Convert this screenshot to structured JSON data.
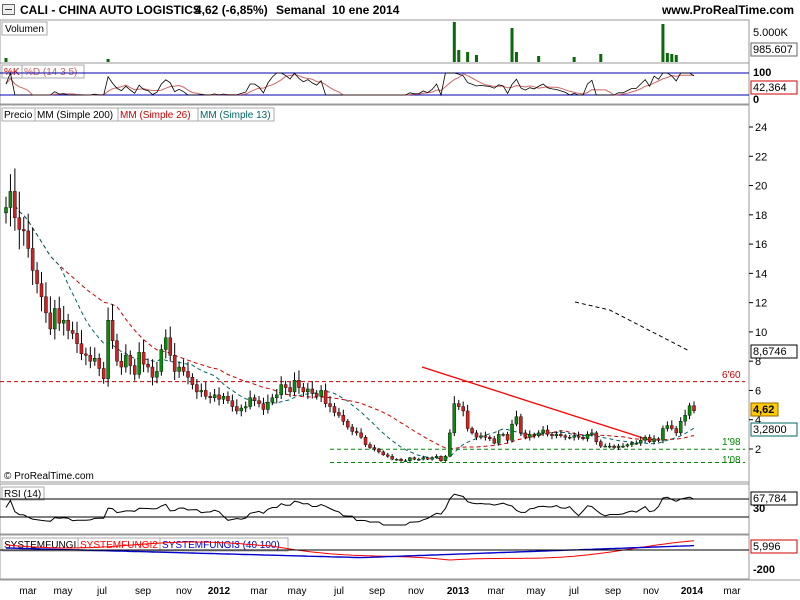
{
  "header": {
    "symbol": "CALI - CHINA AUTO LOGISTICS",
    "price_change": "4,62 (-6,85%)",
    "period": "Semanal",
    "date": "10 ene 2014",
    "brand": "www.ProRealTime.com"
  },
  "panels": {
    "volume": {
      "label": "Volumen",
      "scale_top": "5.000K",
      "current": "985.607"
    },
    "stoch": {
      "label_k": "%K",
      "label_d": "%D (14 3 5)",
      "scale_top": "100",
      "current": "42,364",
      "scale_bottom": "0"
    },
    "price": {
      "labels": [
        "Precio",
        "MM (Simple 200)",
        "MM (Simple 26)",
        "MM (Simple 13)"
      ],
      "current": "4,62",
      "ma200": "8,6746",
      "ma13": "3,2800",
      "line_660": "6'60",
      "line_198": "1'98",
      "line_108": "1'08",
      "copyright": "© ProRealTime.com"
    },
    "rsi": {
      "label": "RSI (14)",
      "current": "67,784",
      "scale_bottom": "30"
    },
    "systemfungi": {
      "labels": [
        "SYSTEMFUNGI",
        "SYSTEMFUNGI2",
        "SYSTEMFUNGI3 (40 100)"
      ],
      "current": "5,996",
      "scale_bottom": "-200"
    }
  },
  "x_axis": [
    "mar",
    "may",
    "jul",
    "sep",
    "nov",
    "2012",
    "mar",
    "may",
    "jul",
    "sep",
    "nov",
    "2013",
    "mar",
    "may",
    "jul",
    "sep",
    "nov",
    "2014",
    "mar"
  ],
  "price_ticks": [
    "24",
    "22",
    "20",
    "18",
    "16",
    "14",
    "12",
    "10",
    "8",
    "6",
    "4",
    "2"
  ],
  "colors": {
    "up": "#0a8a0a",
    "down": "#cc2222",
    "ma26": "#cc0000",
    "ma13": "#006666",
    "ma200": "#000000",
    "trend": "#ff0000",
    "support": "#008800",
    "rsi": "#000000",
    "fungi1": "#000000",
    "fungi2": "#ff0000",
    "fungi3": "#0000cc"
  },
  "chart_data": {
    "type": "candlestick",
    "title": "CALI - CHINA AUTO LOGISTICS",
    "frequency": "weekly",
    "last_close": 4.62,
    "change_pct": -6.85,
    "ylim": [
      0,
      26
    ],
    "ma200_last": 8.6746,
    "ma13_last": 3.28,
    "stoch_d_last": 42.364,
    "rsi_last": 67.784,
    "volume_last": 985607,
    "fungi_last": 5.996,
    "horizontal_levels": [
      6.6,
      1.98,
      1.08
    ],
    "close_series": [
      18.5,
      19.6,
      17.8,
      17.0,
      16.9,
      15.7,
      14.2,
      13.3,
      12.4,
      11.3,
      10.2,
      11.6,
      10.6,
      10.8,
      10.1,
      9.9,
      9.2,
      8.5,
      8.4,
      8.0,
      8.2,
      7.5,
      6.8,
      10.8,
      9.4,
      8.0,
      7.6,
      8.4,
      7.7,
      7.1,
      8.6,
      7.8,
      7.6,
      6.9,
      7.3,
      8.8,
      9.6,
      8.4,
      7.3,
      7.6,
      7.3,
      6.9,
      6.4,
      5.9,
      6.0,
      5.6,
      5.5,
      5.7,
      5.4,
      5.6,
      5.3,
      4.9,
      4.6,
      4.8,
      4.9,
      5.5,
      5.3,
      5.1,
      4.7,
      5.2,
      5.5,
      5.7,
      6.4,
      6.2,
      5.9,
      6.7,
      6.2,
      5.9,
      6.1,
      5.8,
      5.6,
      6.0,
      5.1,
      4.9,
      4.5,
      4.3,
      3.9,
      3.5,
      3.2,
      3.1,
      2.8,
      2.3,
      2.1,
      2.0,
      1.8,
      1.6,
      1.5,
      1.3,
      1.3,
      1.2,
      1.2,
      1.4,
      1.3,
      1.3,
      1.4,
      1.3,
      1.4,
      1.5,
      1.2,
      1.5,
      3.1,
      5.1,
      4.9,
      4.6,
      3.4,
      3.1,
      2.8,
      2.9,
      2.8,
      2.7,
      2.4,
      3.0,
      3.0,
      2.6,
      3.7,
      4.2,
      3.1,
      2.8,
      3.0,
      2.9,
      3.1,
      3.3,
      3.0,
      2.9,
      3.0,
      2.9,
      2.8,
      2.8,
      2.9,
      2.8,
      2.7,
      3.0,
      3.1,
      2.5,
      2.2,
      2.2,
      2.2,
      2.1,
      2.2,
      2.2,
      2.3,
      2.4,
      2.4,
      2.6,
      2.8,
      2.5,
      2.7,
      2.6,
      3.4,
      3.6,
      3.4,
      3.1,
      3.9,
      4.3,
      4.96,
      4.62
    ]
  }
}
